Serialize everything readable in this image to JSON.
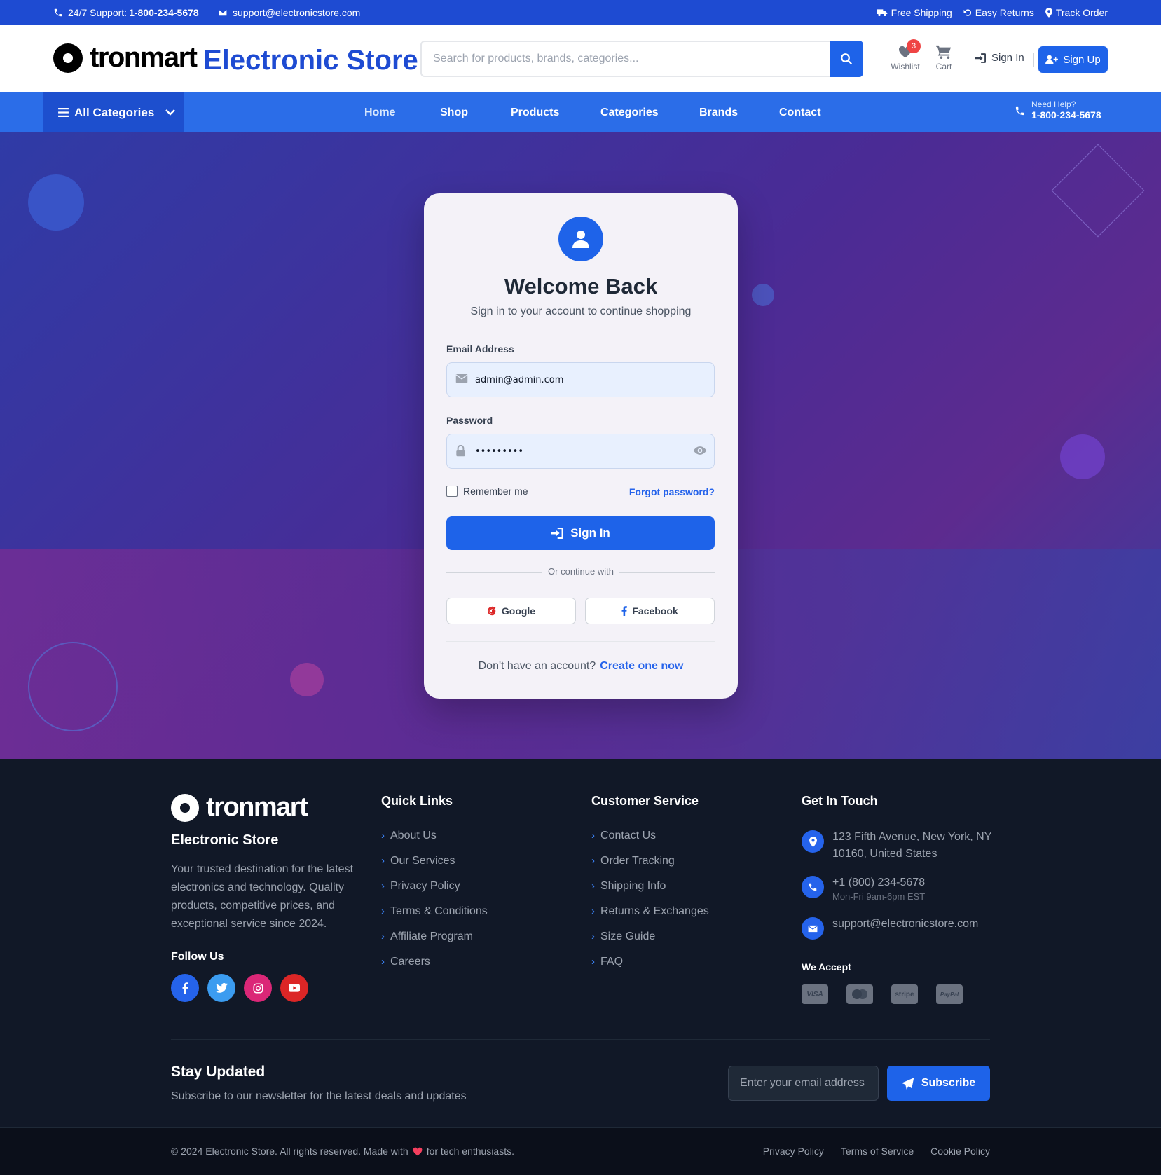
{
  "topbar": {
    "support_label": "24/7 Support:",
    "support_phone": "1-800-234-5678",
    "email": "support@electronicstore.com",
    "free_shipping": "Free Shipping",
    "easy_returns": "Easy Returns",
    "track_order": "Track Order"
  },
  "header": {
    "logo_text": "tronmart",
    "store_name": "Electronic Store",
    "search_placeholder": "Search for products, brands, categories...",
    "wishlist_label": "Wishlist",
    "wishlist_count": "3",
    "cart_label": "Cart",
    "sign_in": "Sign In",
    "sign_up": "Sign Up"
  },
  "nav": {
    "all_categories": "All Categories",
    "links": [
      "Home",
      "Shop",
      "Products",
      "Categories",
      "Brands",
      "Contact"
    ],
    "help_label": "Need Help?",
    "help_phone": "1-800-234-5678"
  },
  "login": {
    "title": "Welcome Back",
    "subtitle": "Sign in to your account to continue shopping",
    "email_label": "Email Address",
    "email_value": "admin@admin.com",
    "password_label": "Password",
    "password_value": "•••••••••",
    "remember_label": "Remember me",
    "remember_checked": false,
    "forgot_label": "Forgot password?",
    "submit_label": "Sign In",
    "divider_text": "Or continue with",
    "google_label": "Google",
    "facebook_label": "Facebook",
    "no_account_text": "Don't have an account?",
    "create_label": "Create one now"
  },
  "footer": {
    "logo_text": "tronmart",
    "store_name": "Electronic Store",
    "about": "Your trusted destination for the latest electronics and technology. Quality products, competitive prices, and exceptional service since 2024.",
    "follow_label": "Follow Us",
    "social_icons": [
      "facebook-icon",
      "twitter-icon",
      "instagram-icon",
      "youtube-icon"
    ],
    "quick_links_title": "Quick Links",
    "quick_links": [
      "About Us",
      "Our Services",
      "Privacy Policy",
      "Terms & Conditions",
      "Affiliate Program",
      "Careers"
    ],
    "customer_service_title": "Customer Service",
    "customer_service": [
      "Contact Us",
      "Order Tracking",
      "Shipping Info",
      "Returns & Exchanges",
      "Size Guide",
      "FAQ"
    ],
    "contact_title": "Get In Touch",
    "address": "123 Fifth Avenue, New York, NY 10160, United States",
    "phone": "+1 (800) 234-5678",
    "hours": "Mon-Fri 9am-6pm EST",
    "email": "support@electronicstore.com",
    "accept_label": "We Accept",
    "payment_methods": [
      "VISA",
      "mastercard",
      "stripe",
      "PayPal"
    ],
    "newsletter_title": "Stay Updated",
    "newsletter_sub": "Subscribe to our newsletter for the latest deals and updates",
    "newsletter_placeholder": "Enter your email address",
    "subscribe_label": "Subscribe",
    "copyright_pre": "© 2024 Electronic Store. All rights reserved. Made with",
    "copyright_post": "for tech enthusiasts.",
    "legal_links": [
      "Privacy Policy",
      "Terms of Service",
      "Cookie Policy"
    ]
  },
  "colors": {
    "primary": "#1e63e9",
    "topbar": "#1e4bd2",
    "nav": "#2b6de8",
    "footer": "#111827",
    "badge": "#ef4444"
  }
}
